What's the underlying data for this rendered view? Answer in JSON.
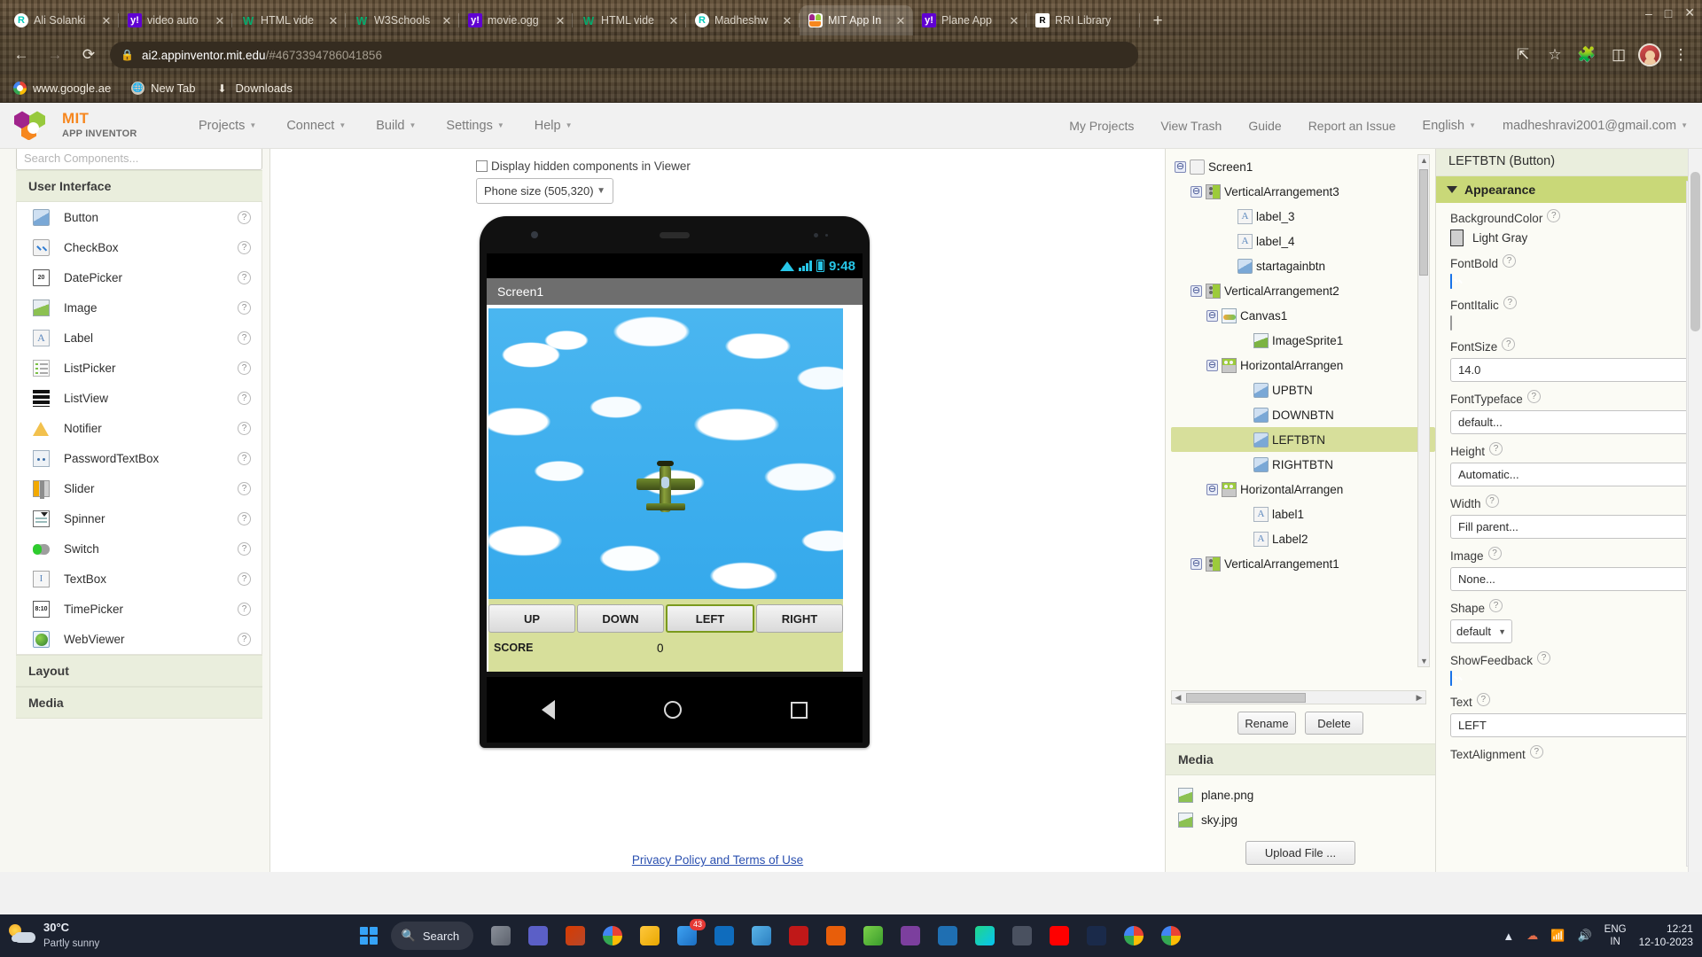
{
  "browser": {
    "tabs": [
      {
        "title": "Ali Solanki",
        "favicon": "rg-icon",
        "active": false
      },
      {
        "title": "video auto",
        "favicon": "yahoo-icon",
        "active": false
      },
      {
        "title": "HTML vide",
        "favicon": "w3schools-icon",
        "active": false
      },
      {
        "title": "W3Schools",
        "favicon": "w3schools-icon",
        "active": false
      },
      {
        "title": "movie.ogg",
        "favicon": "yahoo-icon",
        "active": false
      },
      {
        "title": "HTML vide",
        "favicon": "w3schools-icon",
        "active": false
      },
      {
        "title": "Madheshw",
        "favicon": "rg-icon",
        "active": false
      },
      {
        "title": "MIT App In",
        "favicon": "mit-app-inventor-icon",
        "active": true
      },
      {
        "title": "Plane App",
        "favicon": "yahoo-icon",
        "active": false
      },
      {
        "title": "RRI Library",
        "favicon": "rri-icon",
        "active": false
      }
    ],
    "new_tab_label": "+",
    "close_label": "✕",
    "nav": {
      "back": "←",
      "forward": "→",
      "reload": "⟳",
      "lock": "ὑ2"
    },
    "omnibox": {
      "domain": "ai2.appinventor.mit.edu",
      "path": "/#4673394786041856"
    },
    "toolbar_icons": [
      "share-icon",
      "bookmark-star-icon",
      "extensions-icon",
      "side-panel-icon",
      "profile-avatar"
    ],
    "window_controls": [
      "minimize",
      "maximize",
      "close"
    ],
    "bookmarks": [
      {
        "label": "www.google.ae",
        "icon": "google-icon"
      },
      {
        "label": "New Tab",
        "icon": "globe-icon"
      },
      {
        "label": "Downloads",
        "icon": "download-icon"
      }
    ]
  },
  "appinventor": {
    "logo": {
      "line1": "MIT",
      "line2": "APP INVENTOR"
    },
    "menu": [
      {
        "label": "Projects"
      },
      {
        "label": "Connect"
      },
      {
        "label": "Build"
      },
      {
        "label": "Settings"
      },
      {
        "label": "Help"
      }
    ],
    "header_right": [
      {
        "label": "My Projects"
      },
      {
        "label": "View Trash"
      },
      {
        "label": "Guide"
      },
      {
        "label": "Report an Issue"
      },
      {
        "label": "English",
        "caret": true
      },
      {
        "label": "madheshravi2001@gmail.com",
        "caret": true
      }
    ],
    "palette": {
      "search_placeholder": "Search Components...",
      "sections": [
        {
          "title": "User Interface",
          "expanded": true
        },
        {
          "title": "Layout",
          "expanded": false
        },
        {
          "title": "Media",
          "expanded": false
        }
      ],
      "items": [
        {
          "label": "Button",
          "icon": "button-icon"
        },
        {
          "label": "CheckBox",
          "icon": "checkbox-icon"
        },
        {
          "label": "DatePicker",
          "icon": "datepicker-icon"
        },
        {
          "label": "Image",
          "icon": "image-icon"
        },
        {
          "label": "Label",
          "icon": "label-icon"
        },
        {
          "label": "ListPicker",
          "icon": "listpicker-icon"
        },
        {
          "label": "ListView",
          "icon": "listview-icon"
        },
        {
          "label": "Notifier",
          "icon": "notifier-icon"
        },
        {
          "label": "PasswordTextBox",
          "icon": "password-icon"
        },
        {
          "label": "Slider",
          "icon": "slider-icon"
        },
        {
          "label": "Spinner",
          "icon": "spinner-icon"
        },
        {
          "label": "Switch",
          "icon": "switch-icon"
        },
        {
          "label": "TextBox",
          "icon": "textbox-icon"
        },
        {
          "label": "TimePicker",
          "icon": "timepicker-icon"
        },
        {
          "label": "WebViewer",
          "icon": "webviewer-icon"
        }
      ],
      "help_glyph": "?"
    },
    "viewer": {
      "hidden_components_label": "Display hidden components in Viewer",
      "hidden_components_checked": false,
      "phone_size_value": "Phone size (505,320)",
      "phone": {
        "status_time": "9:48",
        "screen_title": "Screen1",
        "buttons": [
          {
            "label": "UP",
            "selected": false
          },
          {
            "label": "DOWN",
            "selected": false
          },
          {
            "label": "LEFT",
            "selected": true
          },
          {
            "label": "RIGHT",
            "selected": false
          }
        ],
        "score_label": "SCORE",
        "score_value": "0",
        "nav_buttons": [
          "back-icon",
          "home-icon",
          "recents-icon"
        ]
      },
      "privacy_link": "Privacy Policy and Terms of Use"
    },
    "components": {
      "tree": [
        {
          "label": "Screen1",
          "depth": 0,
          "icon": "screen-icon",
          "toggle": "⊖",
          "selected": false
        },
        {
          "label": "VerticalArrangement3",
          "depth": 1,
          "icon": "vertical-arrangement-icon",
          "toggle": "⊖",
          "selected": false
        },
        {
          "label": "label_3",
          "depth": 2,
          "icon": "label-icon",
          "toggle": "",
          "selected": false
        },
        {
          "label": "label_4",
          "depth": 2,
          "icon": "label-icon",
          "toggle": "",
          "selected": false
        },
        {
          "label": "startagainbtn",
          "depth": 2,
          "icon": "button-icon",
          "toggle": "",
          "selected": false
        },
        {
          "label": "VerticalArrangement2",
          "depth": 1,
          "icon": "vertical-arrangement-icon",
          "toggle": "⊖",
          "selected": false
        },
        {
          "label": "Canvas1",
          "depth": 2,
          "icon": "canvas-icon",
          "toggle": "⊖",
          "selected": false
        },
        {
          "label": "ImageSprite1",
          "depth": 3,
          "icon": "sprite-icon",
          "toggle": "",
          "selected": false
        },
        {
          "label": "HorizontalArrangen",
          "depth": 2,
          "icon": "horizontal-arrangement-icon",
          "toggle": "⊖",
          "selected": false
        },
        {
          "label": "UPBTN",
          "depth": 3,
          "icon": "button-icon",
          "toggle": "",
          "selected": false
        },
        {
          "label": "DOWNBTN",
          "depth": 3,
          "icon": "button-icon",
          "toggle": "",
          "selected": false
        },
        {
          "label": "LEFTBTN",
          "depth": 3,
          "icon": "button-icon",
          "toggle": "",
          "selected": true
        },
        {
          "label": "RIGHTBTN",
          "depth": 3,
          "icon": "button-icon",
          "toggle": "",
          "selected": false
        },
        {
          "label": "HorizontalArrangen",
          "depth": 2,
          "icon": "horizontal-arrangement-icon",
          "toggle": "⊖",
          "selected": false
        },
        {
          "label": "label1",
          "depth": 3,
          "icon": "label-icon",
          "toggle": "",
          "selected": false
        },
        {
          "label": "Label2",
          "depth": 3,
          "icon": "label-icon",
          "toggle": "",
          "selected": false
        },
        {
          "label": "VerticalArrangement1",
          "depth": 1,
          "icon": "vertical-arrangement-icon",
          "toggle": "⊖",
          "selected": false
        }
      ],
      "rename_label": "Rename",
      "delete_label": "Delete"
    },
    "media": {
      "title": "Media",
      "files": [
        {
          "name": "plane.png"
        },
        {
          "name": "sky.jpg"
        }
      ],
      "upload_label": "Upload File ..."
    },
    "properties": {
      "title": "LEFTBTN (Button)",
      "section": "Appearance",
      "fields": [
        {
          "label": "BackgroundColor",
          "type": "color",
          "value": "Light Gray",
          "swatch": "#cfcfcf"
        },
        {
          "label": "FontBold",
          "type": "checkbox",
          "checked": true
        },
        {
          "label": "FontItalic",
          "type": "checkbox",
          "checked": false
        },
        {
          "label": "FontSize",
          "type": "text",
          "value": "14.0"
        },
        {
          "label": "FontTypeface",
          "type": "text",
          "value": "default..."
        },
        {
          "label": "Height",
          "type": "text",
          "value": "Automatic..."
        },
        {
          "label": "Width",
          "type": "text",
          "value": "Fill parent..."
        },
        {
          "label": "Image",
          "type": "text",
          "value": "None..."
        },
        {
          "label": "Shape",
          "type": "select",
          "value": "default"
        },
        {
          "label": "ShowFeedback",
          "type": "checkbox",
          "checked": true
        },
        {
          "label": "Text",
          "type": "text",
          "value": "LEFT"
        },
        {
          "label": "TextAlignment",
          "type": "label-only"
        }
      ]
    }
  },
  "taskbar": {
    "weather": {
      "temp": "30°C",
      "desc": "Partly sunny"
    },
    "search_label": "Search",
    "mail_badge": "43",
    "language": {
      "line1": "ENG",
      "line2": "IN"
    },
    "clock": {
      "time": "12:21",
      "date": "12-10-2023"
    },
    "tray_icons": [
      "chevron-up-icon",
      "onedrive-icon",
      "wifi-icon",
      "volume-icon"
    ]
  }
}
